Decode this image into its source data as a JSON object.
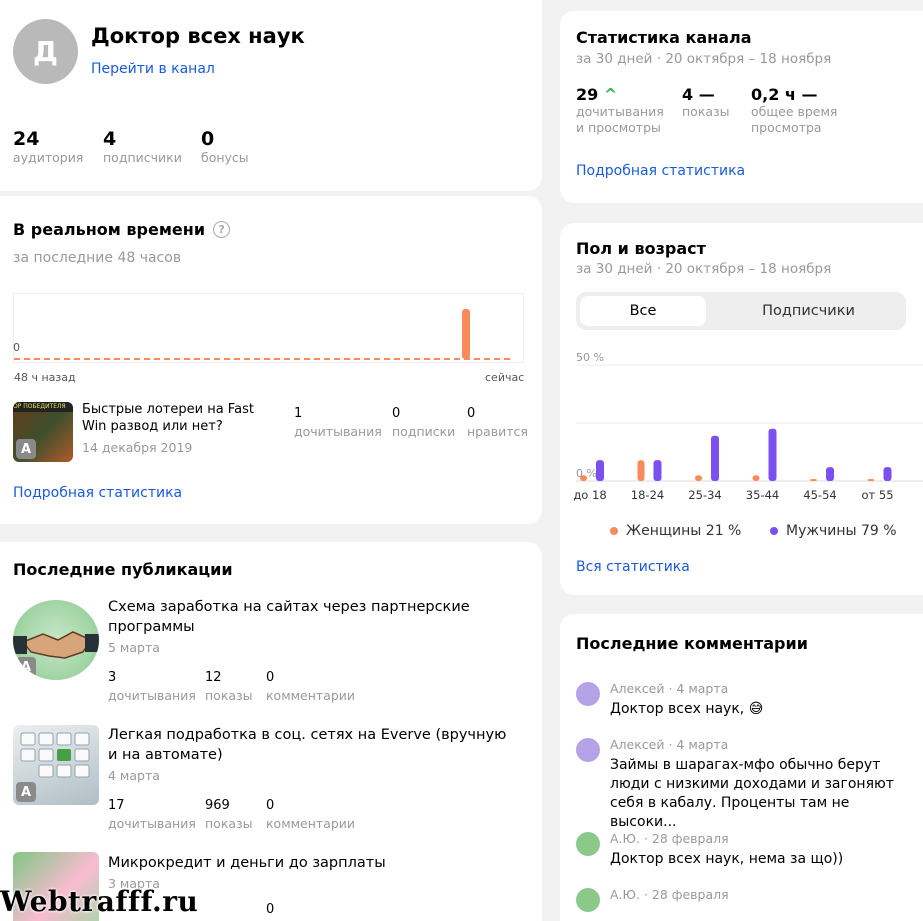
{
  "profile": {
    "avatar_letter": "Д",
    "name": "Доктор всех наук",
    "channel_link": "Перейти в канал",
    "stats": [
      {
        "value": "24",
        "label": "аудитория"
      },
      {
        "value": "4",
        "label": "подписчики"
      },
      {
        "value": "0",
        "label": "бонусы"
      }
    ]
  },
  "realtime": {
    "title": "В реальном времени",
    "subtitle": "за последние 48 часов",
    "zero_label": "0",
    "axis_left": "48 ч назад",
    "axis_right": "сейчас",
    "spike_fraction": 0.8,
    "article": {
      "title": "Быстрые лотереи на Fast Win развод или нет?",
      "date": "14 декабря 2019",
      "thumb_caption": "ОР ПОБЕДИТЕЛЯ",
      "stats": [
        {
          "value": "1",
          "label": "дочитывания"
        },
        {
          "value": "0",
          "label": "подписки"
        },
        {
          "value": "0",
          "label": "нравится"
        }
      ]
    },
    "more_link": "Подробная статистика"
  },
  "publications": {
    "title": "Последние публикации",
    "items": [
      {
        "title": "Схема заработка на сайтах через партнерские программы",
        "date": "5 марта",
        "stats": [
          {
            "value": "3",
            "label": "дочитывания"
          },
          {
            "value": "12",
            "label": "показы"
          },
          {
            "value": "0",
            "label": "комментарии"
          }
        ]
      },
      {
        "title": "Легкая подработка в соц. сетях на Everve (вручную и на автомате)",
        "date": "4 марта",
        "stats": [
          {
            "value": "17",
            "label": "дочитывания"
          },
          {
            "value": "969",
            "label": "показы"
          },
          {
            "value": "0",
            "label": "комментарии"
          }
        ]
      },
      {
        "title": "Микрокредит и деньги до зарплаты",
        "date": "3 марта",
        "stats": [
          {
            "value": "",
            "label": ""
          },
          {
            "value": "0",
            "label": ""
          },
          {
            "value": "",
            "label": ""
          }
        ]
      }
    ],
    "badge_letter": "А"
  },
  "channel_stats": {
    "title": "Статистика канала",
    "period": "за 30 дней · 20 октября – 18 ноября",
    "items": [
      {
        "value": "29",
        "trend": "^",
        "label1": "дочитывания",
        "label2": "и просмотры"
      },
      {
        "value": "4",
        "trend": "—",
        "label1": "показы",
        "label2": ""
      },
      {
        "value": "0,2 ч",
        "trend": "—",
        "label1": "общее время",
        "label2": "просмотра"
      }
    ],
    "more_link": "Подробная статистика",
    "trend_up_color": "#2ebb4f"
  },
  "gender_age": {
    "title": "Пол и возраст",
    "period": "за 30 дней · 20 октября – 18 ноября",
    "tabs": [
      "Все",
      "Подписчики"
    ],
    "more_link": "Вся статистика",
    "legend": [
      {
        "name": "Женщины 21 %",
        "color": "#f98a5b"
      },
      {
        "name": "Мужчины 79 %",
        "color": "#7b4ff0"
      }
    ]
  },
  "chart_data": {
    "type": "bar",
    "title": "",
    "categories": [
      "до 18",
      "18-24",
      "25-34",
      "35-44",
      "45-54",
      "от 55"
    ],
    "series": [
      {
        "name": "Женщины 21 %",
        "values": [
          0.5,
          1.8,
          0.5,
          0.5,
          0.1,
          0.1
        ]
      },
      {
        "name": "Мужчины 79 %",
        "values": [
          1.8,
          1.8,
          3.9,
          4.5,
          1.2,
          1.2
        ]
      }
    ],
    "ytick_labels": [
      "50 %",
      "0 %"
    ],
    "ylim": [
      0,
      10
    ],
    "grid": true
  },
  "comments": {
    "title": "Последние комментарии",
    "items": [
      {
        "author": "Алексей · 4 марта",
        "text": "Доктор всех наук, 😅",
        "avatar_color": "#b6a2e6"
      },
      {
        "author": "Алексей · 4 марта",
        "text": "Займы в шарагах-мфо обычно берут люди с низкими доходами и загоняют себя в кабалу. Проценты там не высоки...",
        "avatar_color": "#b6a2e6"
      },
      {
        "author": "А.Ю. · 28 февраля",
        "text": "Доктор всех наук, нема за що))",
        "avatar_color": "#8bc98b"
      },
      {
        "author": "А.Ю. · 28 февраля",
        "text": "",
        "avatar_color": "#8bc98b"
      }
    ]
  },
  "watermark": "Webtrafff.ru"
}
